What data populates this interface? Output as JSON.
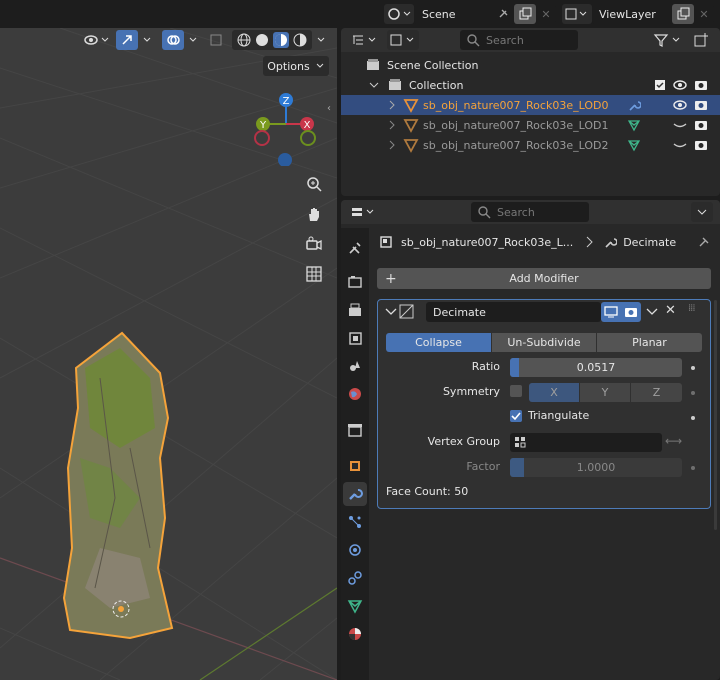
{
  "header": {
    "scene_label": "Scene",
    "view_layer_label": "ViewLayer"
  },
  "viewport": {
    "options_label": "Options",
    "gizmo": {
      "z": "Z",
      "x": "X",
      "y": "Y"
    }
  },
  "outliner": {
    "search_placeholder": "Search",
    "scene_collection": "Scene Collection",
    "collection": "Collection",
    "objects": [
      {
        "name": "sb_obj_nature007_Rock03e_LOD0",
        "selected": true
      },
      {
        "name": "sb_obj_nature007_Rock03e_LOD1",
        "selected": false
      },
      {
        "name": "sb_obj_nature007_Rock03e_LOD2",
        "selected": false
      }
    ]
  },
  "properties": {
    "search_placeholder": "Search",
    "breadcrumb_object": "sb_obj_nature007_Rock03e_L...",
    "breadcrumb_modifier": "Decimate",
    "add_modifier_label": "Add Modifier",
    "modifier": {
      "name": "Decimate",
      "modes": [
        "Collapse",
        "Un-Subdivide",
        "Planar"
      ],
      "active_mode": "Collapse",
      "ratio_label": "Ratio",
      "ratio_value": "0.0517",
      "ratio": 0.0517,
      "symmetry_label": "Symmetry",
      "axes": [
        "X",
        "Y",
        "Z"
      ],
      "triangulate_label": "Triangulate",
      "triangulate_checked": true,
      "vertex_group_label": "Vertex Group",
      "factor_label": "Factor",
      "factor_value": "1.0000",
      "face_count": "Face Count: 50"
    }
  },
  "colors": {
    "accent": "#4772b3",
    "selected_row": "#334d80",
    "object_orange": "#e8923a",
    "axis_x": "#c9364a",
    "axis_y": "#7a9a1e",
    "axis_z": "#2e7bd6"
  }
}
